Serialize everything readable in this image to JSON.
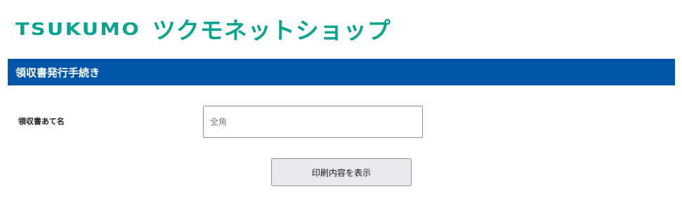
{
  "header": {
    "logo_en": "TSUKUMO",
    "logo_jp": "ツクモネットショップ"
  },
  "section": {
    "title": "領収書発行手続き"
  },
  "form": {
    "recipient_label": "領収書あて名",
    "recipient_value": "",
    "recipient_placeholder": "全角",
    "print_button_label": "印刷内容を表示"
  },
  "colors": {
    "brand_green": "#0aa390",
    "section_blue": "#0055a6",
    "button_bg": "#e9e9ed"
  }
}
